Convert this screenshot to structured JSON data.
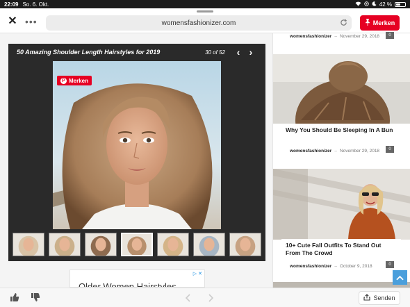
{
  "status_bar": {
    "time": "22:09",
    "date": "So. 6. Okt.",
    "battery": "42 %",
    "battery_level": 0.42
  },
  "browser": {
    "url": "womensfashionizer.com",
    "merken_label": "Merken",
    "close_icon": "close-icon",
    "more_icon": "more-icon",
    "reload_icon": "reload-icon"
  },
  "gallery": {
    "title": "50 Amazing Shoulder Length Hairstyles for 2019",
    "counter": "30 of 52",
    "prev_icon": "chevron-left-icon",
    "next_icon": "chevron-right-icon",
    "pin_label": "Merken",
    "thumb_count": 7,
    "active_thumb": 3
  },
  "ad": {
    "text": "Older Women Hairstyles"
  },
  "articles": [
    {
      "author": "womensfashionizer",
      "date": "November 29, 2018",
      "comments": "0"
    },
    {
      "title": "Why You Should Be Sleeping In A Bun",
      "author": "womensfashionizer",
      "date": "November 29, 2018",
      "comments": "0"
    },
    {
      "title": "10+ Cute Fall Outfits To Stand Out From The Crowd",
      "author": "womensfashionizer",
      "date": "October 9, 2018",
      "comments": "0"
    }
  ],
  "toolbar": {
    "send_label": "Senden"
  },
  "colors": {
    "pinterest_red": "#e60023",
    "gallery_bg": "#2a2a2a",
    "scroll_top_blue": "#4a9fdc"
  }
}
